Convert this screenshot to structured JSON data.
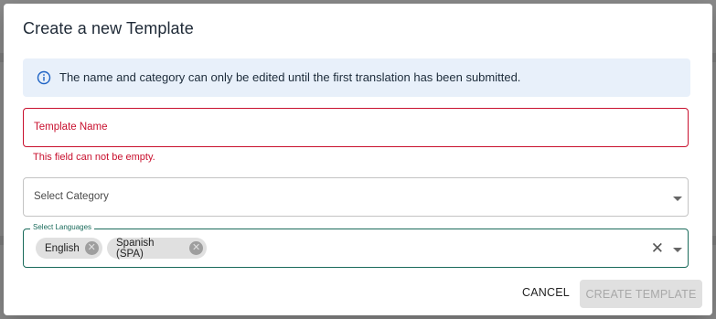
{
  "dialog": {
    "title": "Create a new Template",
    "info_icon": "info-icon",
    "info_message": "The name and category can only be edited until the first translation has been submitted.",
    "template_name": {
      "label": "Template Name",
      "value": "",
      "error": "This field can not be empty."
    },
    "category": {
      "label": "Select Category",
      "value": ""
    },
    "languages": {
      "label": "Select Languages",
      "selected": [
        {
          "label": "English"
        },
        {
          "label": "Spanish (SPA)"
        }
      ],
      "clear_icon": "close-icon",
      "remove_icon": "cancel-circle-icon"
    },
    "actions": {
      "cancel_label": "CANCEL",
      "create_label": "CREATE TEMPLATE",
      "create_disabled": true
    }
  },
  "colors": {
    "error": "#c8102e",
    "focus": "#1a6b5b",
    "info_background": "#e8f0fa",
    "info_icon": "#1e63c4",
    "disabled_button": "#e0e0e0"
  }
}
